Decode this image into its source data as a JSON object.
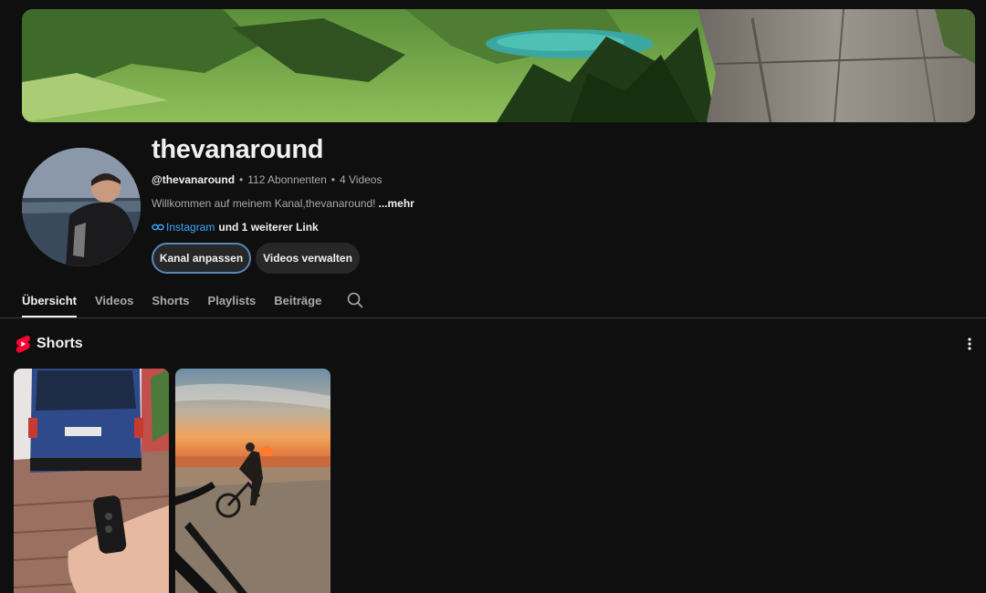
{
  "channel": {
    "name": "thevanaround",
    "handle": "@thevanaround",
    "subscribers": "112 Abonnenten",
    "videos_count": "4 Videos",
    "separator": "•",
    "description": "Willkommen auf meinem Kanal,thevanaround!",
    "description_more": "...mehr",
    "link_label": "Instagram",
    "more_links": "und 1 weiterer Link"
  },
  "buttons": {
    "customize": "Kanal anpassen",
    "manage": "Videos verwalten"
  },
  "tabs": [
    {
      "label": "Übersicht",
      "active": true
    },
    {
      "label": "Videos",
      "active": false
    },
    {
      "label": "Shorts",
      "active": false
    },
    {
      "label": "Playlists",
      "active": false
    },
    {
      "label": "Beiträge",
      "active": false
    }
  ],
  "shorts_section": {
    "title": "Shorts"
  },
  "icons": {
    "tab_search": "search-icon",
    "section_menu": "more-vertical-icon",
    "shorts_logo": "shorts-logo-icon",
    "link": "link-icon"
  },
  "colors": {
    "background": "#0f0f0f",
    "text_primary": "#f1f1f1",
    "text_secondary": "#aaaaaa",
    "link": "#3ea6ff",
    "button_bg": "#272727",
    "shorts_red": "#ff0033"
  }
}
